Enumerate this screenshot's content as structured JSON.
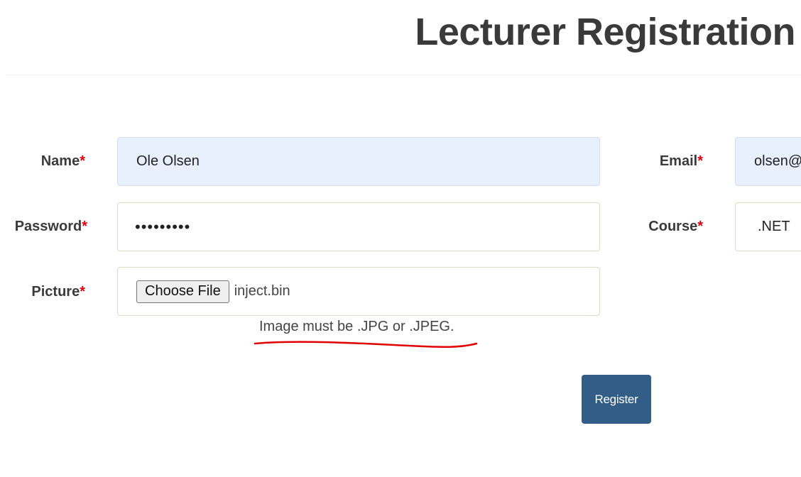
{
  "header": {
    "title": "Lecturer Registration"
  },
  "form": {
    "required_marker": "*",
    "name": {
      "label": "Name",
      "value": "Ole Olsen"
    },
    "email": {
      "label": "Email",
      "value": "olsen@"
    },
    "password": {
      "label": "Password",
      "value": "•••••••••"
    },
    "course": {
      "label": "Course",
      "value": ".NET"
    },
    "picture": {
      "label": "Picture",
      "button_label": "Choose File",
      "file_name": "inject.bin",
      "hint": "Image must be .JPG or .JPEG."
    },
    "submit_label": "Register"
  },
  "colors": {
    "accent": "#325d86",
    "required": "#e3000f",
    "autofill_bg": "#e8f0fe",
    "annotation": "#e00000"
  }
}
